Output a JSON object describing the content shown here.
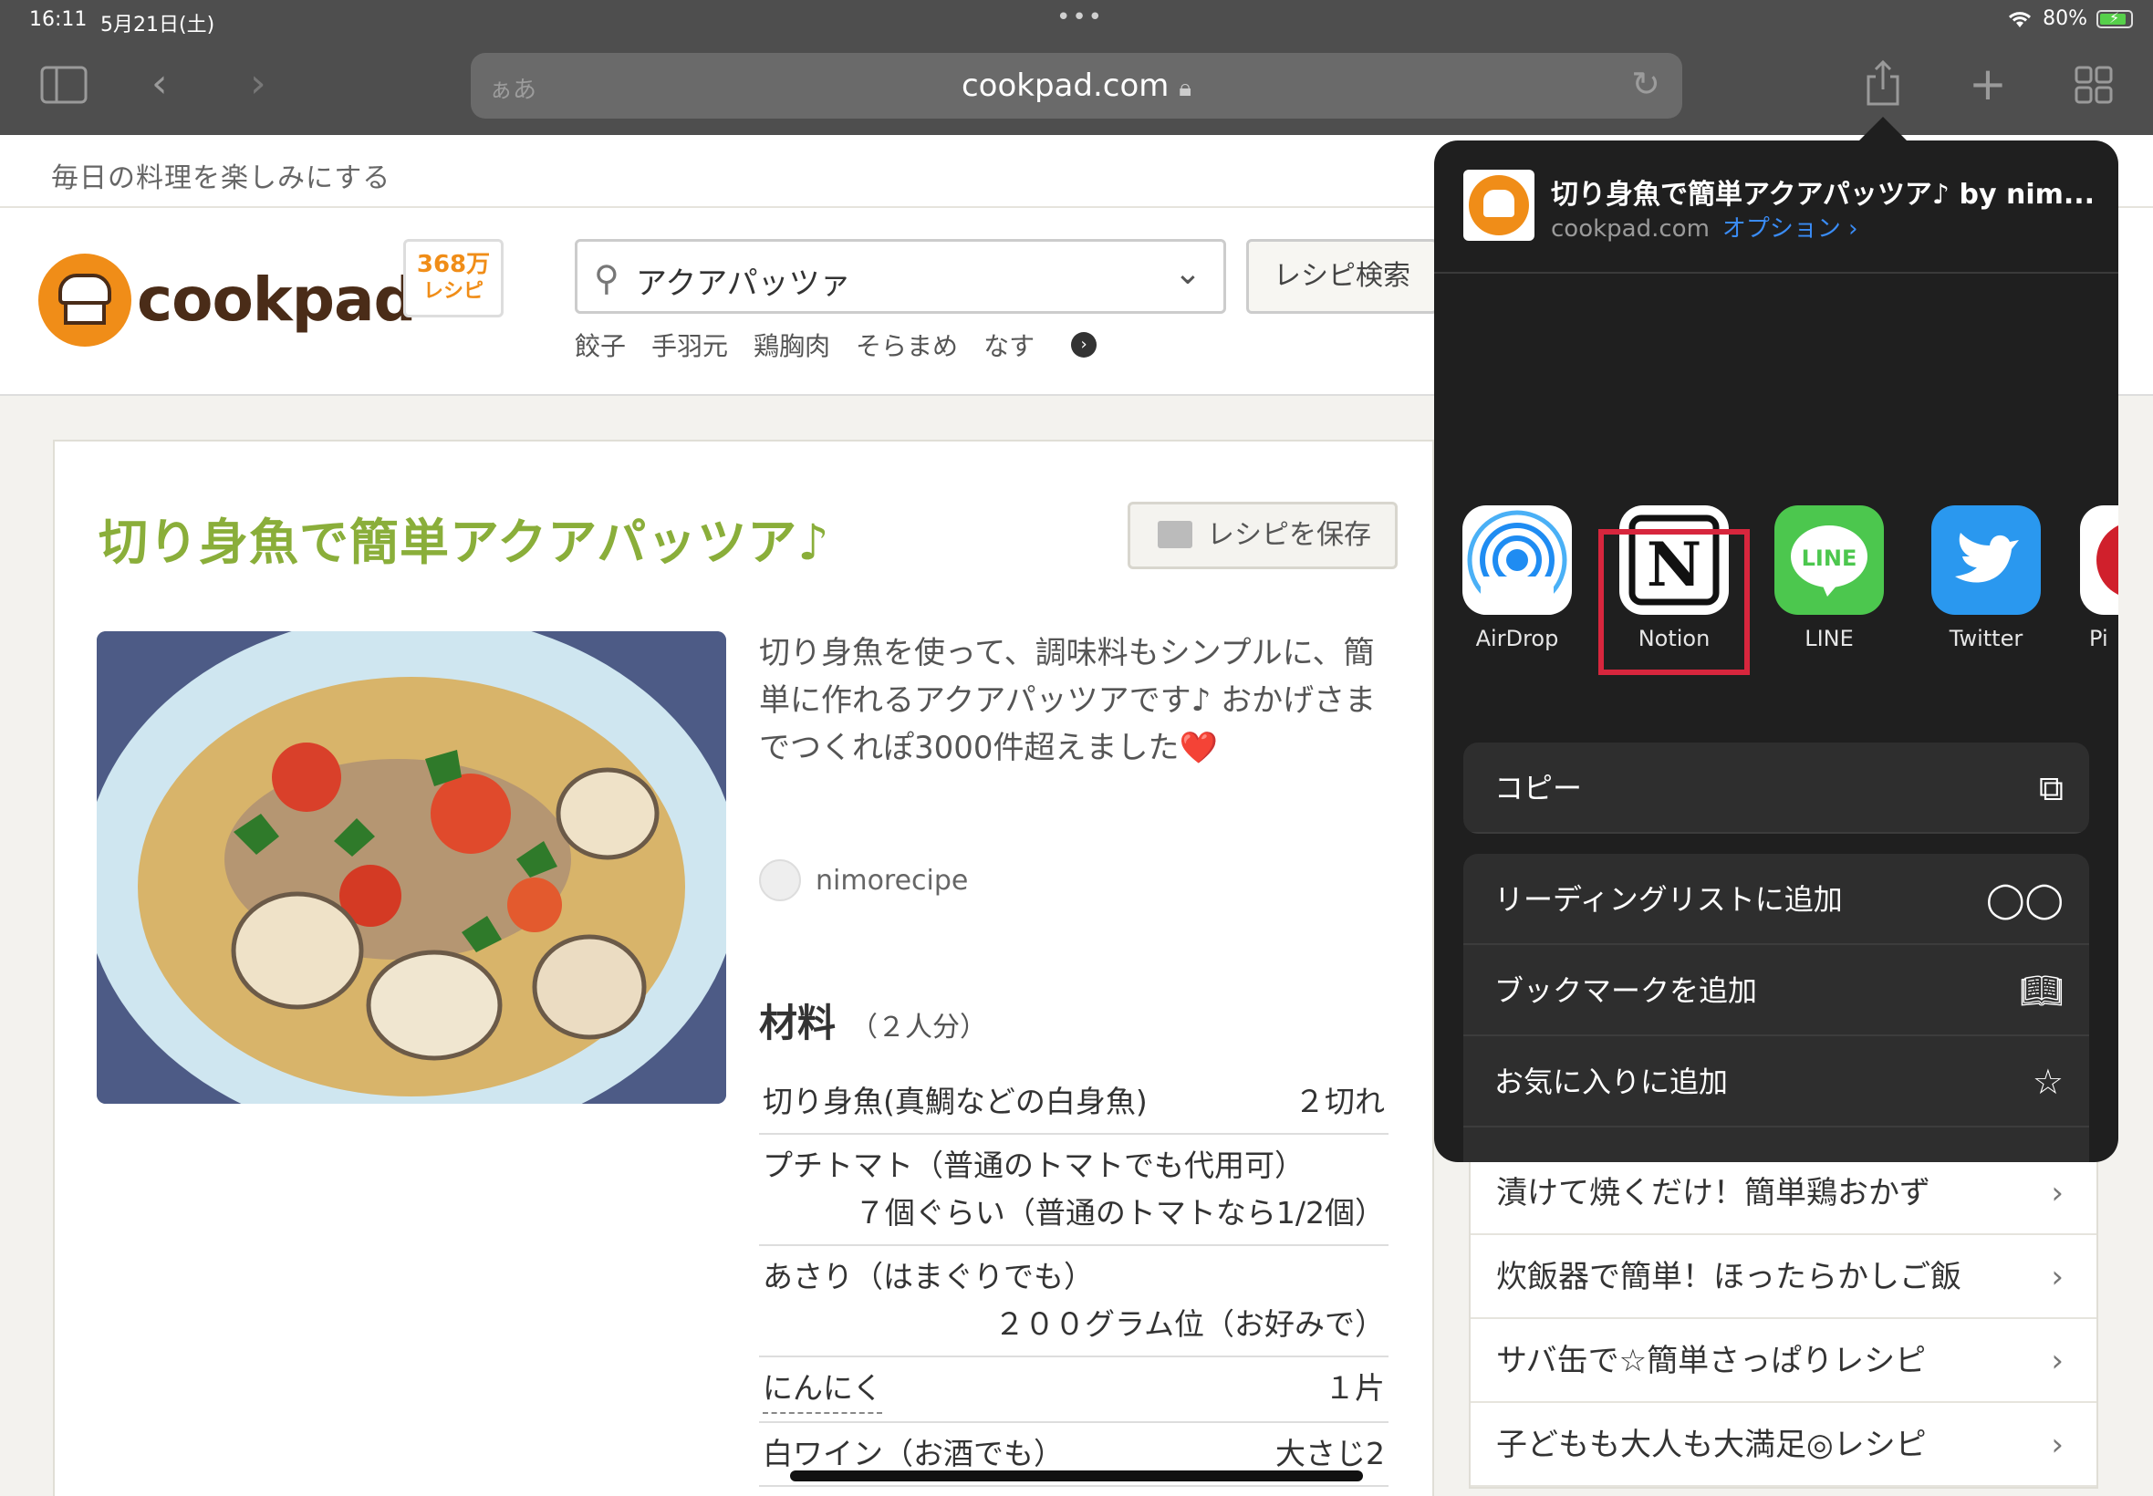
{
  "status": {
    "time": "16:11",
    "date": "5月21日(土)",
    "battery": "80%"
  },
  "toolbar": {
    "aa": "ぁあ",
    "url": "cookpad.com"
  },
  "page": {
    "tagline": "毎日の料理を楽しみにする",
    "logo_text": "cookpad",
    "recipe_count": "368万",
    "recipe_count_unit": "レシピ",
    "search_value": "アクアパッツァ",
    "search_button": "レシピ検索",
    "keywords": [
      "餃子",
      "手羽元",
      "鶏胸肉",
      "そらまめ",
      "なす"
    ],
    "recipe_title": "切り身魚で簡単アクアパッツア♪",
    "save_button": "レシピを保存",
    "description": "切り身魚を使って、調味料もシンプルに、簡単に作れるアクアパッツアです♪ おかげさまでつくれぽ3000件超えました❤️",
    "author": "nimorecipe",
    "ingredients_title": "材料",
    "servings": "（２人分）",
    "ingredients": [
      {
        "name": "切り身魚(真鯛などの白身魚)",
        "qty": "２切れ",
        "cont": ""
      },
      {
        "name": "プチトマト（普通のトマトでも代用可）",
        "qty": "",
        "cont": "７個ぐらい（普通のトマトなら1/2個）"
      },
      {
        "name": "あさり（はまぐりでも）",
        "qty": "",
        "cont": "２００グラム位（お好みで）"
      },
      {
        "name": "にんにく",
        "qty": "１片",
        "cont": ""
      },
      {
        "name": "白ワイン（お酒でも）",
        "qty": "大さじ2",
        "cont": ""
      }
    ],
    "side_list": [
      "漬けて焼くだけ！簡単鶏おかず",
      "炊飯器で簡単！ほったらかしご飯",
      "サバ缶で☆簡単さっぱりレシピ",
      "子どもも大人も大満足◎レシピ"
    ]
  },
  "share": {
    "title": "切り身魚で簡単アクアパッツア♪ by nim...",
    "domain": "cookpad.com",
    "option": "オプション ›",
    "apps": [
      {
        "label": "AirDrop"
      },
      {
        "label": "Notion"
      },
      {
        "label": "LINE"
      },
      {
        "label": "Twitter"
      },
      {
        "label": "Pi"
      }
    ],
    "copy": "コピー",
    "actions": [
      "リーディングリストに追加",
      "ブックマークを追加",
      "お気に入りに追加"
    ]
  },
  "colors": {
    "accent_green": "#8aae3a",
    "brand_orange": "#f08d18",
    "highlight_red": "#d7263d"
  }
}
